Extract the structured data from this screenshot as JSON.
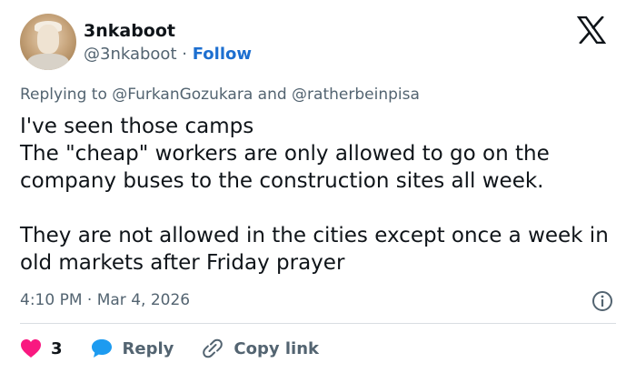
{
  "author": {
    "name": "3nkaboot",
    "handle": "@3nkaboot",
    "separator": "·",
    "follow_label": "Follow"
  },
  "reply_context": {
    "prefix": "Replying to",
    "mention_1": "@FurkanGozukara",
    "conjunction": "and",
    "mention_2": "@ratherbeinpisa"
  },
  "tweet": {
    "line_1": "I've seen those camps",
    "line_2": "The \"cheap\" workers are only allowed to go on the company buses to the construction sites all week.",
    "line_3": "They are not allowed in the cities except once a week in old markets after Friday prayer",
    "time": "4:10 PM",
    "separator": "·",
    "date": "Mar 4, 2026"
  },
  "actions": {
    "like_count": "3",
    "reply_label": "Reply",
    "copy_link_label": "Copy link"
  },
  "icons": {
    "logo": "x-logo-icon",
    "info": "info-icon",
    "like": "heart-icon",
    "reply": "speech-bubble-icon",
    "copy": "link-icon"
  },
  "colors": {
    "text": "#0f1419",
    "secondary": "#536471",
    "link": "#1d6fd0",
    "like": "#f91880",
    "reply": "#1d9bf0",
    "divider": "#d9dee2"
  }
}
